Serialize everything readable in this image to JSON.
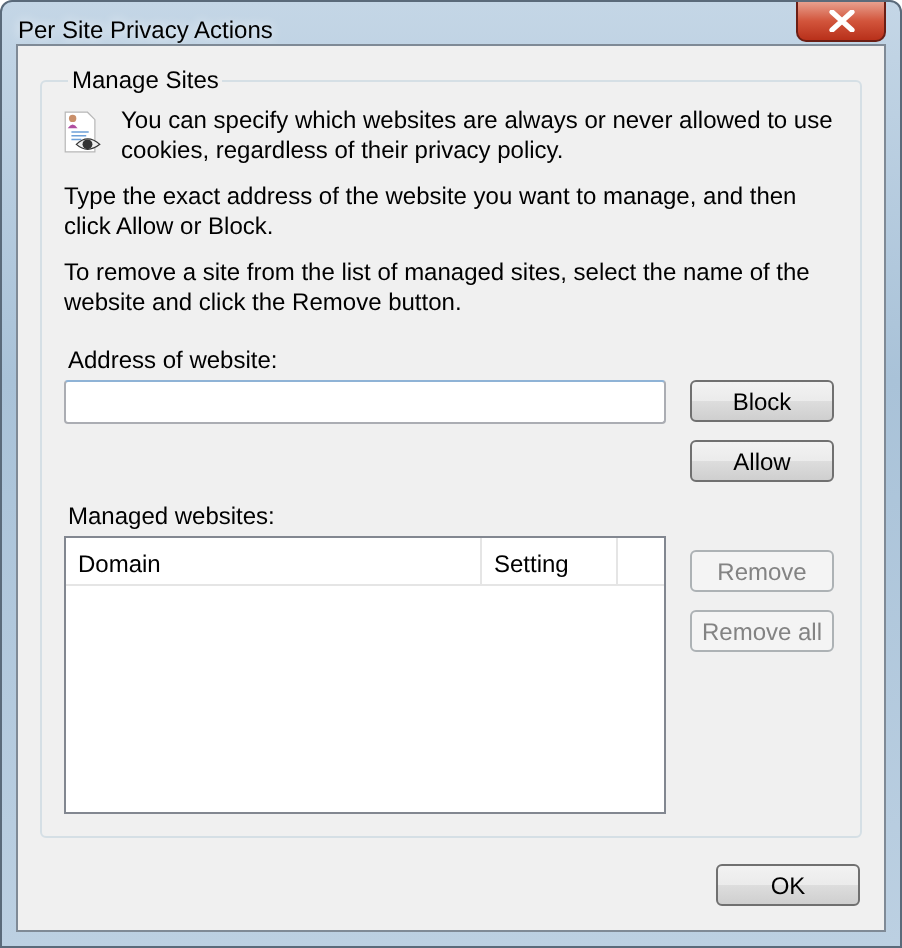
{
  "window": {
    "title": "Per Site Privacy Actions"
  },
  "group": {
    "title": "Manage Sites",
    "intro": "You can specify which websites are always or never allowed to use cookies, regardless of their privacy policy.",
    "paragraphs": [
      "Type the exact address of the website you want to manage, and then click Allow or Block.",
      "To remove a site from the list of managed sites, select the name of the website and click the Remove button."
    ]
  },
  "address": {
    "label": "Address of website:"
  },
  "site_buttons": [
    {
      "label": "Block",
      "disabled": false
    },
    {
      "label": "Allow",
      "disabled": false
    }
  ],
  "managed": {
    "label": "Managed websites:",
    "columns": [
      "Domain",
      "Setting"
    ]
  },
  "list_buttons": [
    {
      "label": "Remove",
      "disabled": true
    },
    {
      "label": "Remove all",
      "disabled": true
    }
  ],
  "ok": {
    "label": "OK"
  }
}
